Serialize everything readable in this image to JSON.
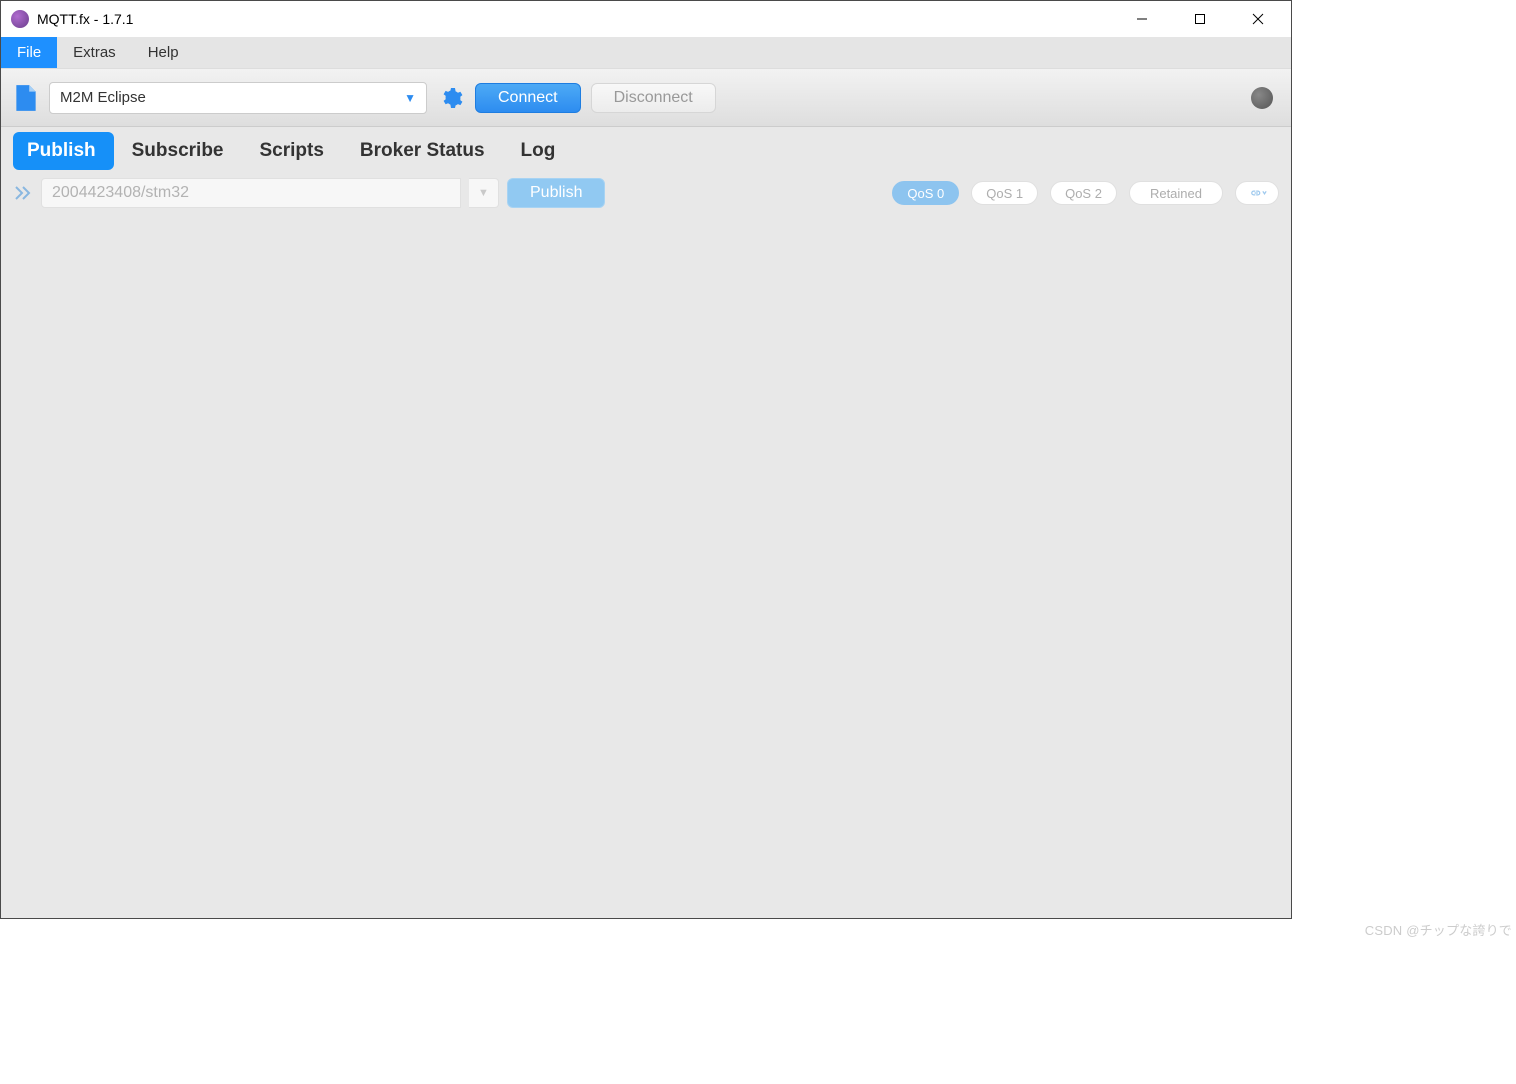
{
  "titlebar": {
    "title": "MQTT.fx - 1.7.1"
  },
  "menubar": {
    "items": [
      {
        "label": "File",
        "active": true
      },
      {
        "label": "Extras",
        "active": false
      },
      {
        "label": "Help",
        "active": false
      }
    ]
  },
  "connection": {
    "profile": "M2M Eclipse",
    "connect_label": "Connect",
    "disconnect_label": "Disconnect"
  },
  "tabs": {
    "items": [
      {
        "label": "Publish",
        "active": true
      },
      {
        "label": "Subscribe",
        "active": false
      },
      {
        "label": "Scripts",
        "active": false
      },
      {
        "label": "Broker Status",
        "active": false
      },
      {
        "label": "Log",
        "active": false
      }
    ]
  },
  "publish": {
    "topic": "2004423408/stm32",
    "publish_label": "Publish",
    "qos": {
      "options": [
        "QoS 0",
        "QoS 1",
        "QoS 2"
      ],
      "selected": 0
    },
    "retained_label": "Retained"
  },
  "watermark": "CSDN @チップな誇りで"
}
